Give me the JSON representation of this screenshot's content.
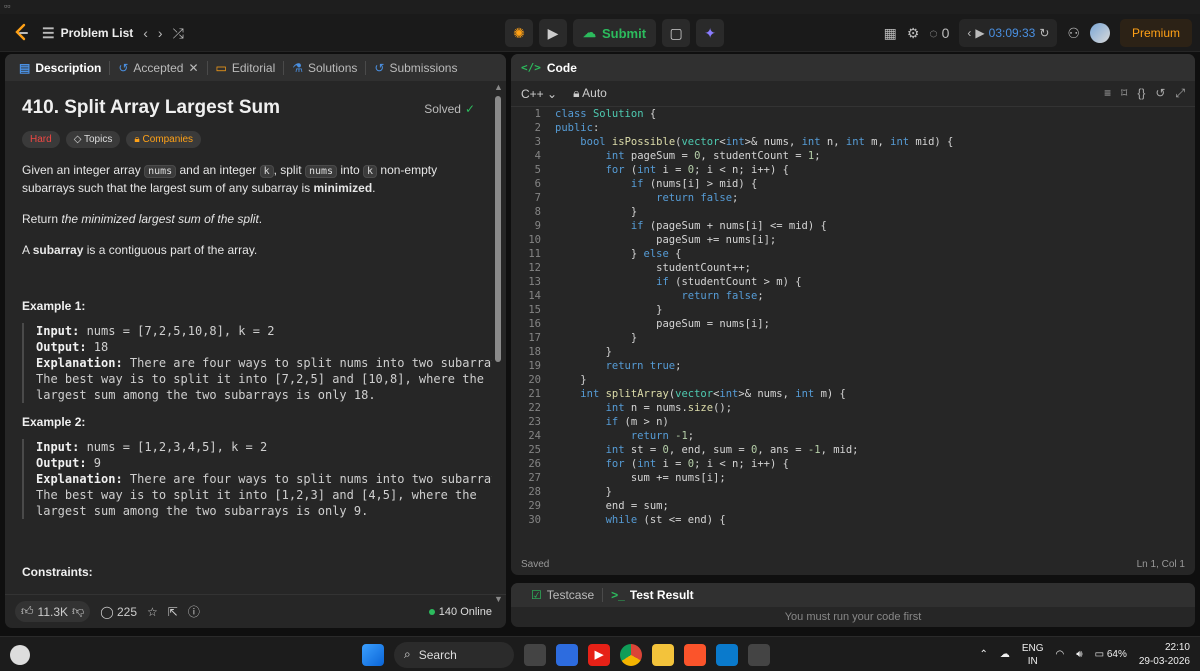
{
  "navbar": {
    "problem_list": "Problem List",
    "submit": "Submit",
    "streak": "0",
    "timer": "03:09:33",
    "premium": "Premium"
  },
  "tabs": {
    "description": "Description",
    "accepted": "Accepted",
    "editorial": "Editorial",
    "solutions": "Solutions",
    "submissions": "Submissions"
  },
  "problem": {
    "title": "410. Split Array Largest Sum",
    "solved": "Solved",
    "difficulty": "Hard",
    "topics": "Topics",
    "companies": "Companies",
    "p1_a": "Given an integer array ",
    "p1_code1": "nums",
    "p1_b": " and an integer ",
    "p1_code2": "k",
    "p1_c": ", split ",
    "p1_code3": "nums",
    "p1_d": " into ",
    "p1_code4": "k",
    "p1_e": " non-empty subarrays such that the largest sum of any subarray is ",
    "p1_bold": "minimized",
    "p1_f": ".",
    "p2_a": "Return ",
    "p2_italic": "the minimized largest sum of the split",
    "p2_b": ".",
    "p3_a": "A ",
    "p3_bold": "subarray",
    "p3_b": " is a contiguous part of the array.",
    "example1_heading": "Example 1:",
    "example1_input_label": "Input:",
    "example1_input": " nums = [7,2,5,10,8], k = 2",
    "example1_output_label": "Output:",
    "example1_output": " 18",
    "example1_expl_label": "Explanation:",
    "example1_expl": " There are four ways to split nums into two subarrays.\nThe best way is to split it into [7,2,5] and [10,8], where the\nlargest sum among the two subarrays is only 18.",
    "example2_heading": "Example 2:",
    "example2_input_label": "Input:",
    "example2_input": " nums = [1,2,3,4,5], k = 2",
    "example2_output_label": "Output:",
    "example2_output": " 9",
    "example2_expl_label": "Explanation:",
    "example2_expl": " There are four ways to split nums into two subarrays.\nThe best way is to split it into [1,2,3] and [4,5], where the\nlargest sum among the two subarrays is only 9.",
    "constraints_heading": "Constraints:"
  },
  "footer": {
    "likes": "11.3K",
    "comments": "225",
    "online": "140 Online"
  },
  "code": {
    "title": "Code",
    "language": "C++",
    "auto": "Auto",
    "saved": "Saved",
    "cursor": "Ln 1, Col 1",
    "lines": [
      "class Solution {",
      "public:",
      "    bool isPossible(vector<int>& nums, int n, int m, int mid) {",
      "        int pageSum = 0, studentCount = 1;",
      "        for (int i = 0; i < n; i++) {",
      "            if (nums[i] > mid) {",
      "                return false;",
      "            }",
      "            if (pageSum + nums[i] <= mid) {",
      "                pageSum += nums[i];",
      "            } else {",
      "                studentCount++;",
      "                if (studentCount > m) {",
      "                    return false;",
      "                }",
      "                pageSum = nums[i];",
      "            }",
      "        }",
      "        return true;",
      "    }",
      "    int splitArray(vector<int>& nums, int m) {",
      "        int n = nums.size();",
      "        if (m > n)",
      "            return -1;",
      "        int st = 0, end, sum = 0, ans = -1, mid;",
      "        for (int i = 0; i < n; i++) {",
      "            sum += nums[i];",
      "        }",
      "        end = sum;",
      "        while (st <= end) {"
    ]
  },
  "testpanel": {
    "testcase": "Testcase",
    "result": "Test Result",
    "message": "You must run your code first"
  },
  "taskbar": {
    "search": "Search",
    "lang1": "ENG",
    "lang2": "IN",
    "battery": "64%",
    "time": "22:10",
    "date": "29-03-2026"
  }
}
